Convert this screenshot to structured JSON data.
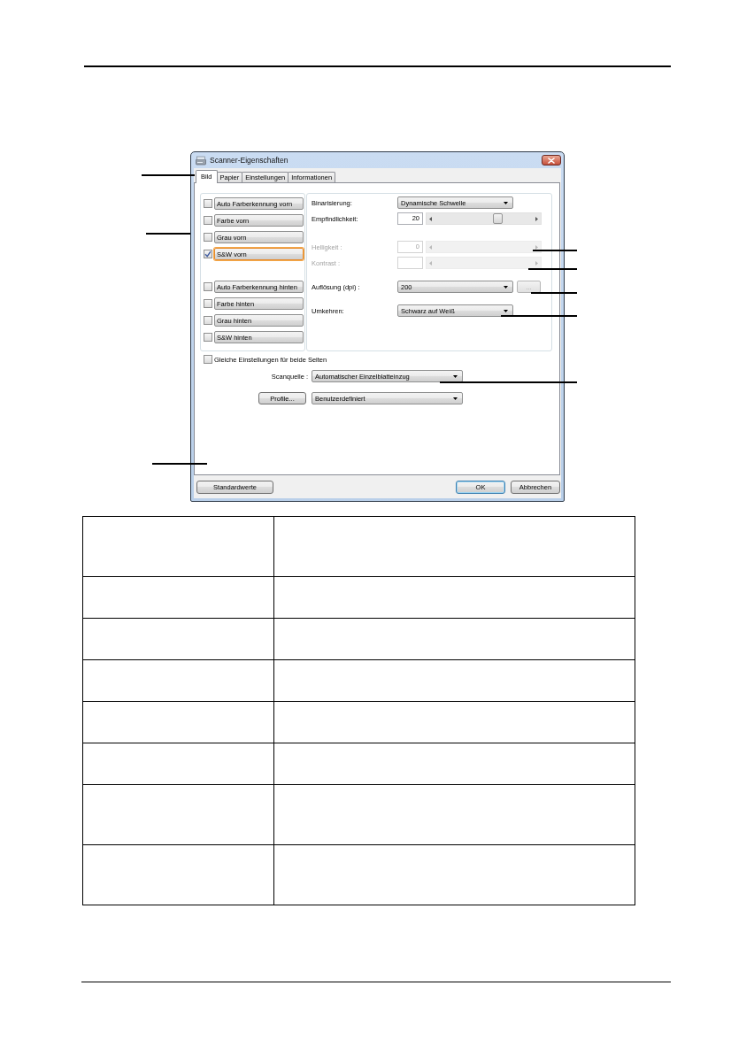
{
  "dialog": {
    "title": "Scanner-Eigenschaften",
    "tabs": [
      {
        "label": "Bild",
        "selected": true
      },
      {
        "label": "Papier",
        "selected": false
      },
      {
        "label": "Einstellungen",
        "selected": false
      },
      {
        "label": "Informationen",
        "selected": false
      }
    ],
    "image_types": {
      "front": [
        {
          "label": "Auto Farberkennung vorn",
          "checked": false,
          "selected": false
        },
        {
          "label": "Farbe vorn",
          "checked": false,
          "selected": false
        },
        {
          "label": "Grau vorn",
          "checked": false,
          "selected": false
        },
        {
          "label": "S&W vorn",
          "checked": true,
          "selected": true
        }
      ],
      "back": [
        {
          "label": "Auto Farberkennung hinten",
          "checked": false,
          "selected": false
        },
        {
          "label": "Farbe hinten",
          "checked": false,
          "selected": false
        },
        {
          "label": "Grau hinten",
          "checked": false,
          "selected": false
        },
        {
          "label": "S&W hinten",
          "checked": false,
          "selected": false
        }
      ]
    },
    "setting_groups": [
      [
        {
          "kind": "dropdown",
          "label": "Binarisierung:",
          "value": "Dynamische Schwelle",
          "disabled": false
        },
        {
          "kind": "slider",
          "label": "Empfindlichkeit:",
          "value": "20",
          "level": 0.65,
          "disabled": false
        }
      ],
      [
        {
          "kind": "slider",
          "label": "Helligkeit :",
          "value": "0",
          "disabled": true
        },
        {
          "kind": "slider",
          "label": "Kontrast :",
          "disabled": true
        }
      ],
      [
        {
          "kind": "dropdown",
          "label": "Auflösung (dpi) :",
          "value": "200",
          "disabled": false,
          "button": {
            "label": "...",
            "disabled": true
          }
        }
      ],
      [
        {
          "kind": "dropdown",
          "label": "Umkehren:",
          "value": "Schwarz auf Weiß",
          "disabled": false
        }
      ]
    ],
    "same_for_both_sides": {
      "label": "Gleiche Einstellungen für beide Seiten",
      "checked": false
    },
    "scan_source": {
      "label": "Scanquelle :",
      "value": "Automatischer Einzelblatteinzug"
    },
    "profile": {
      "button": "Profile...",
      "value": "Benutzerdefiniert"
    },
    "footer": {
      "left": [
        {
          "label": "Standardwerte",
          "default": false
        }
      ],
      "right": [
        {
          "label": "OK",
          "default": true
        },
        {
          "label": "Abbrechen",
          "default": false
        }
      ]
    }
  },
  "table": {
    "rows": [
      {
        "kind": "tall"
      },
      {
        "kind": "short"
      },
      {
        "kind": "short"
      },
      {
        "kind": "short"
      },
      {
        "kind": "short"
      },
      {
        "kind": "short"
      },
      {
        "kind": "tall"
      },
      {
        "kind": "tall"
      }
    ]
  }
}
